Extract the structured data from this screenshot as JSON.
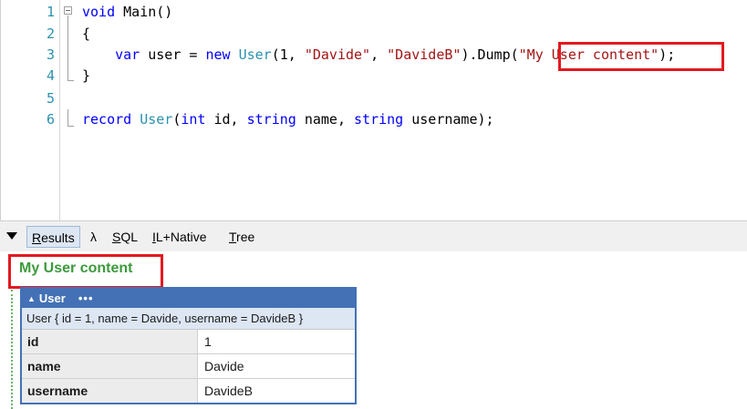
{
  "editor": {
    "lines": [
      {
        "number": "1",
        "tokens": [
          {
            "t": "void",
            "c": "kw"
          },
          {
            "t": " Main()",
            "c": ""
          }
        ]
      },
      {
        "number": "2",
        "tokens": [
          {
            "t": "{",
            "c": ""
          }
        ]
      },
      {
        "number": "3",
        "tokens": [
          {
            "t": "    ",
            "c": ""
          },
          {
            "t": "var",
            "c": "kw"
          },
          {
            "t": " user = ",
            "c": ""
          },
          {
            "t": "new",
            "c": "kw"
          },
          {
            "t": " ",
            "c": ""
          },
          {
            "t": "User",
            "c": "ty"
          },
          {
            "t": "(1, ",
            "c": ""
          },
          {
            "t": "\"Davide\"",
            "c": "str"
          },
          {
            "t": ", ",
            "c": ""
          },
          {
            "t": "\"DavideB\"",
            "c": "str"
          },
          {
            "t": ").Dump(",
            "c": ""
          },
          {
            "t": "\"My User content\"",
            "c": "str"
          },
          {
            "t": ");",
            "c": ""
          }
        ]
      },
      {
        "number": "4",
        "tokens": [
          {
            "t": "}",
            "c": ""
          }
        ]
      },
      {
        "number": "5",
        "tokens": []
      },
      {
        "number": "6",
        "tokens": [
          {
            "t": "record",
            "c": "kw"
          },
          {
            "t": " ",
            "c": ""
          },
          {
            "t": "User",
            "c": "ty"
          },
          {
            "t": "(",
            "c": ""
          },
          {
            "t": "int",
            "c": "kw"
          },
          {
            "t": " id, ",
            "c": ""
          },
          {
            "t": "string",
            "c": "kw"
          },
          {
            "t": " name, ",
            "c": ""
          },
          {
            "t": "string",
            "c": "kw"
          },
          {
            "t": " username);",
            "c": ""
          }
        ]
      }
    ]
  },
  "toolbar": {
    "collapse_icon": "triangle-down-icon",
    "tabs": [
      {
        "label_u": "R",
        "label_rest": "esults",
        "active": true
      },
      {
        "label_u": "",
        "label_rest": "λ",
        "active": false
      },
      {
        "label_u": "S",
        "label_rest": "QL",
        "active": false
      },
      {
        "label_u": "I",
        "label_rest": "L+Native",
        "active": false
      },
      {
        "label_u": "T",
        "label_rest": "ree",
        "active": false
      }
    ]
  },
  "results": {
    "heading": "My User content",
    "dump": {
      "type_label": "User",
      "menu_glyph": "•••",
      "summary": "User { id = 1, name = Davide, username = DavideB }",
      "rows": [
        {
          "key": "id",
          "value": "1"
        },
        {
          "key": "name",
          "value": "Davide"
        },
        {
          "key": "username",
          "value": "DavideB"
        }
      ]
    }
  },
  "colors": {
    "highlight": "#e3191f",
    "heading_green": "#3c9a3c",
    "dump_blue": "#4471b5"
  }
}
